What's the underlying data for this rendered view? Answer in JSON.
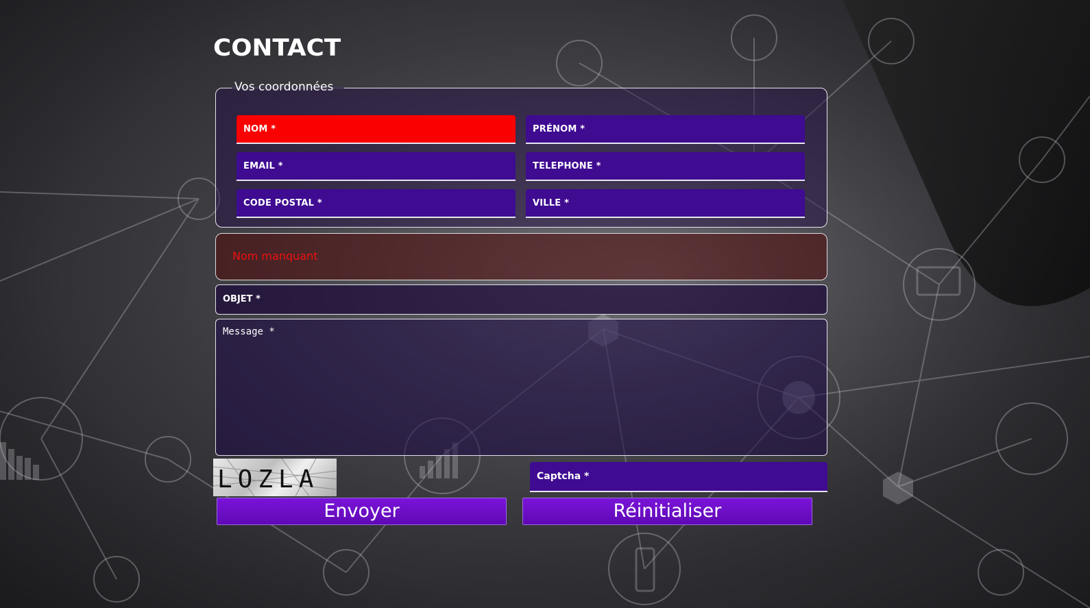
{
  "page": {
    "title": "CONTACT"
  },
  "coordinates": {
    "legend": "Vos coordonnées",
    "fields": {
      "nom": "NOM *",
      "prenom": "PRÉNOM *",
      "email": "EMAIL *",
      "telephone": "TELEPHONE *",
      "code_postal": "CODE POSTAL *",
      "ville": "VILLE *"
    }
  },
  "validation": {
    "error_message": "Nom manquant",
    "error_color": "#fa0000"
  },
  "objet": {
    "placeholder": "OBJET *"
  },
  "message": {
    "placeholder": "Message *"
  },
  "captcha": {
    "code": "LOZLA",
    "input_placeholder": "Captcha *"
  },
  "buttons": {
    "submit": "Envoyer",
    "reset": "Réinitialiser"
  },
  "colors": {
    "field_bg": "#3e0b91",
    "button_bg": "#6a0fc8",
    "text": "#ffffff"
  }
}
